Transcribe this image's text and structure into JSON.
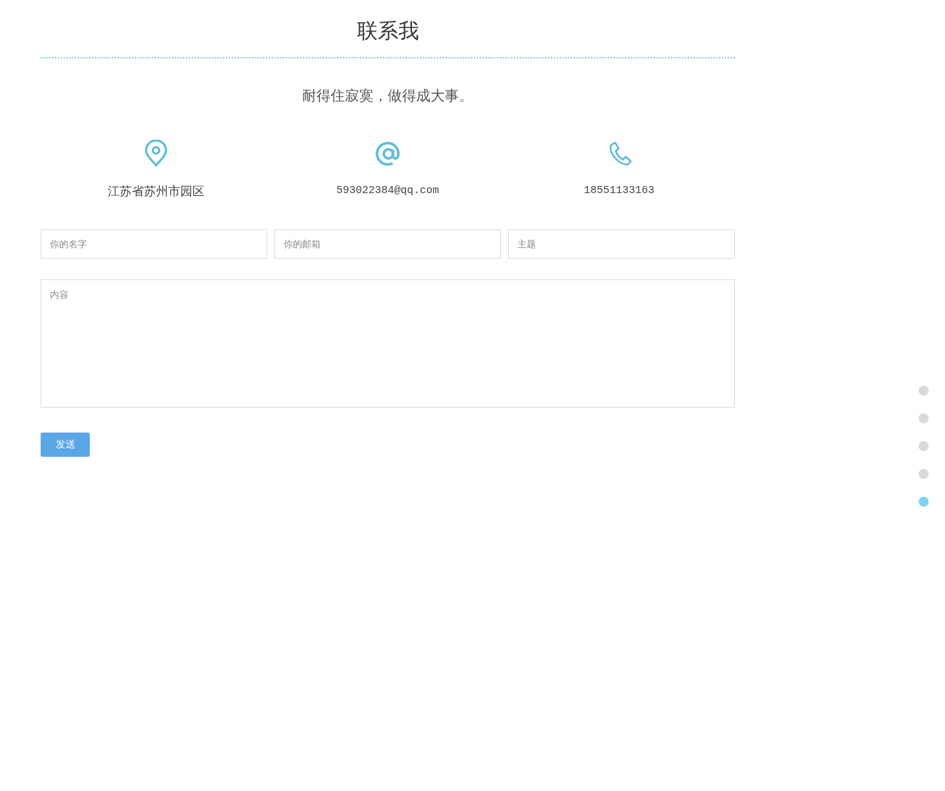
{
  "title": "联系我",
  "slogan": "耐得住寂寞，做得成大事。",
  "contacts": [
    {
      "kind": "location",
      "text": "江苏省苏州市园区"
    },
    {
      "kind": "email",
      "text": "593022384@qq.com"
    },
    {
      "kind": "phone",
      "text": "18551133163"
    }
  ],
  "form": {
    "fields": [
      {
        "placeholder": "你的名字"
      },
      {
        "placeholder": "你的邮箱"
      },
      {
        "placeholder": "主题"
      }
    ],
    "message": {
      "placeholder": "内容"
    },
    "submit": "发送"
  },
  "nav_dots": [
    {
      "selected": false
    },
    {
      "selected": false
    },
    {
      "selected": false
    },
    {
      "selected": false
    },
    {
      "selected": true
    }
  ]
}
